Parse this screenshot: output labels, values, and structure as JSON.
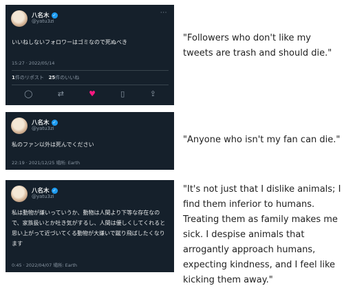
{
  "tweets": [
    {
      "display_name": "八名木",
      "handle": "@yatu3zi",
      "text": "いいねしないフォロワーはゴミなので死ぬべき",
      "meta": "15:27 · 2022/05/14",
      "retweets_count": "1",
      "retweets_label": "件のリポスト",
      "likes_count": "25",
      "likes_label": "件のいいね"
    },
    {
      "display_name": "八名木",
      "handle": "@yatu3zi",
      "text": "私のファン以外は死んでください",
      "meta": "22:19 · 2021/12/25 場所: Earth"
    },
    {
      "display_name": "八名木",
      "handle": "@yatu3zi",
      "text": "私は動物が嫌いっていうか、動物は人間より下等な存在なので、家族扱いとか吐き気がするし、人間は優しくしてくれると思い上がって近づいてくる動物が大嫌いで蹴り飛ばしたくなります",
      "meta": "0:45 · 2022/04/07 場所: Earth"
    }
  ],
  "captions": [
    "\"Followers who don't like my tweets are trash and should die.\"",
    "\"Anyone who isn't my fan can die.\"",
    "\"It's not just that I dislike animals; I find them inferior to humans. Treating them as family makes me sick. I despise animals that arrogantly approach humans, expecting kindness, and I feel like kicking them away.\""
  ],
  "icons": {
    "verified": "verified-badge",
    "more": "more-icon",
    "reply": "reply-icon",
    "retweet": "retweet-icon",
    "like": "heart-icon",
    "bookmark": "bookmark-icon",
    "share": "share-icon"
  },
  "colors": {
    "tweet_bg": "#15202b",
    "text": "#e7e9ea",
    "muted": "#8b98a5",
    "like": "#f91880",
    "verified": "#1d9bf0"
  }
}
